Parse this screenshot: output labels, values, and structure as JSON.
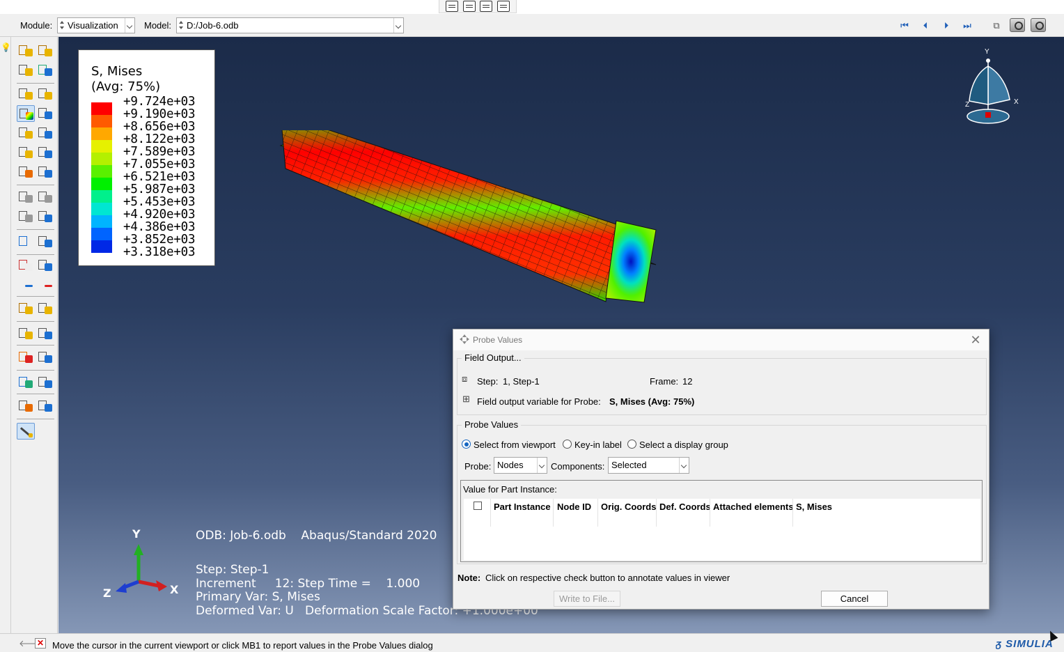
{
  "context_bar": {
    "module_label": "Module:",
    "module_value": "Visualization",
    "model_label": "Model:",
    "model_value": "D:/Job-6.odb"
  },
  "legend": {
    "title_line1": "S, Mises",
    "title_line2": "(Avg: 75%)",
    "values": [
      "+9.724e+03",
      "+9.190e+03",
      "+8.656e+03",
      "+8.122e+03",
      "+7.589e+03",
      "+7.055e+03",
      "+6.521e+03",
      "+5.987e+03",
      "+5.453e+03",
      "+4.920e+03",
      "+4.386e+03",
      "+3.852e+03",
      "+3.318e+03"
    ],
    "colors": [
      "#ff0000",
      "#ff5a00",
      "#ffa800",
      "#e6f000",
      "#b4f000",
      "#5af000",
      "#00f000",
      "#00f08c",
      "#00e6d2",
      "#00b4ff",
      "#0064ff",
      "#0028e6",
      "#0000c8"
    ]
  },
  "viewport_info": {
    "odb_line": "ODB: Job-6.odb    Abaqus/Standard 2020",
    "step_line": "Step: Step-1",
    "increment_line": "Increment     12: Step Time =    1.000",
    "primary_var_line": "Primary Var: S, Mises",
    "deformed_var_line": "Deformed Var: U   Deformation Scale Factor: +1.000e+00"
  },
  "triad_labels": {
    "y": "Y",
    "x": "X",
    "z": "Z"
  },
  "dialog": {
    "title": "Probe Values",
    "field_output_group": "Field Output...",
    "step_label": "Step:",
    "step_value": "1, Step-1",
    "frame_label": "Frame:",
    "frame_value": "12",
    "field_var_label": "Field output variable for Probe:",
    "field_var_value": "S, Mises (Avg: 75%)",
    "probe_values_group": "Probe Values",
    "radio_viewport": "Select from viewport",
    "radio_keyin": "Key-in label",
    "radio_display_group": "Select a display group",
    "probe_label": "Probe:",
    "probe_value": "Nodes",
    "components_label": "Components:",
    "components_value": "Selected",
    "table_title": "Value for Part Instance:",
    "columns": [
      "Part Instance",
      "Node ID",
      "Orig. Coords",
      "Def. Coords",
      "Attached elements",
      "S, Mises"
    ],
    "note_label": "Note:",
    "note_text": "Click on respective check button to annotate values in viewer",
    "write_button": "Write to File...",
    "cancel_button": "Cancel"
  },
  "status_bar": {
    "message": "Move the cursor in the current viewport or click MB1 to report values in the Probe Values dialog",
    "brand": "SIMULIA"
  }
}
